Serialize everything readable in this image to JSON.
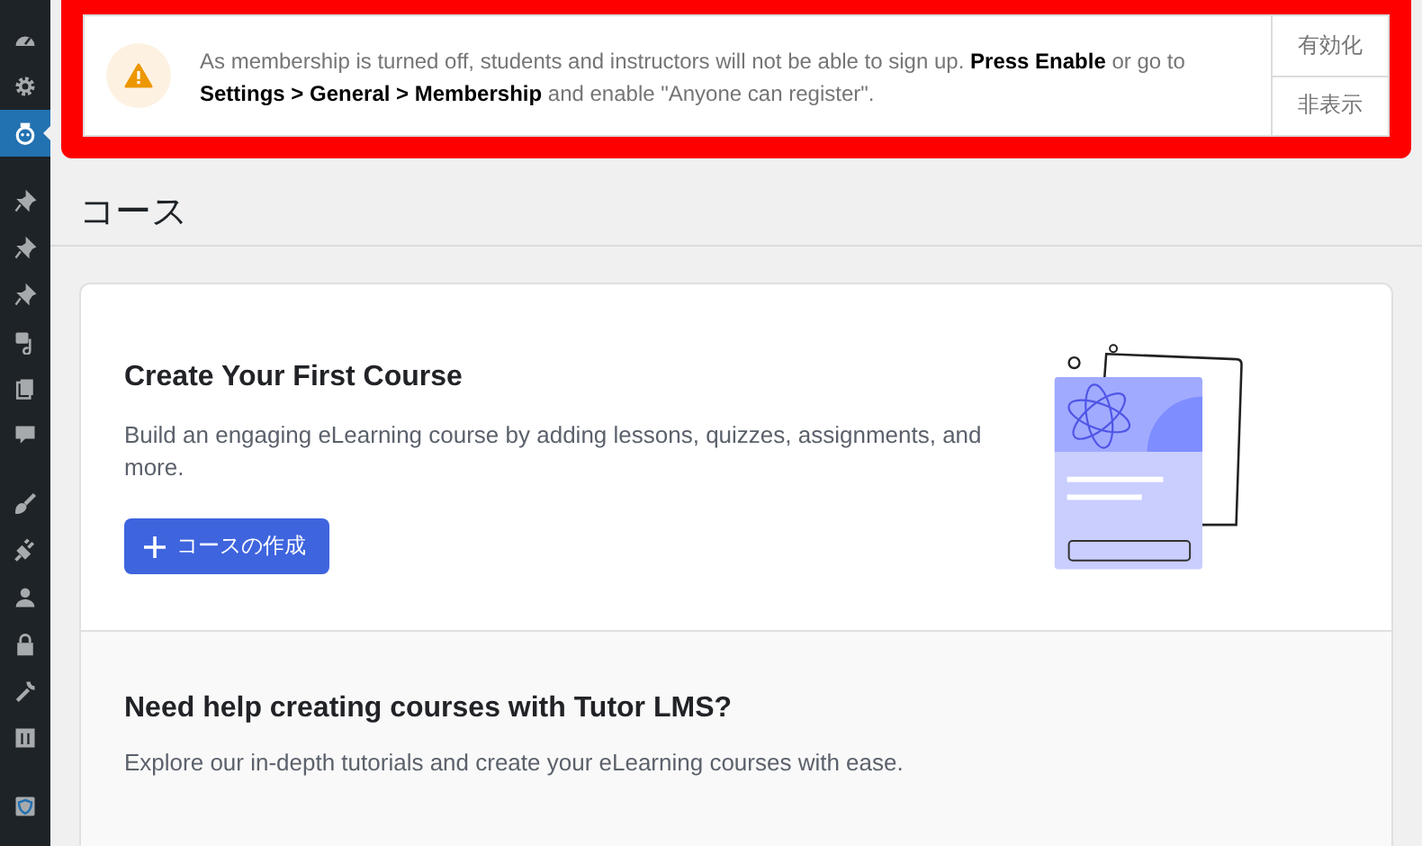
{
  "sidebar": {
    "groups": [
      [
        {
          "kind": "dashboard",
          "selected": false
        },
        {
          "kind": "gear",
          "selected": false
        },
        {
          "kind": "tutor",
          "selected": true
        }
      ],
      [
        {
          "kind": "pin",
          "selected": false
        },
        {
          "kind": "pin",
          "selected": false
        },
        {
          "kind": "pin",
          "selected": false
        },
        {
          "kind": "media",
          "selected": false
        },
        {
          "kind": "pages",
          "selected": false
        },
        {
          "kind": "comment",
          "selected": false
        }
      ],
      [
        {
          "kind": "brush",
          "selected": false
        },
        {
          "kind": "plugin",
          "selected": false
        },
        {
          "kind": "user",
          "selected": false
        },
        {
          "kind": "lock",
          "selected": false
        },
        {
          "kind": "wrench",
          "selected": false
        },
        {
          "kind": "grid",
          "selected": false
        }
      ],
      [
        {
          "kind": "shield",
          "selected": false
        }
      ]
    ]
  },
  "notice": {
    "highlighted": true,
    "message": "As membership is turned off, students and instructors will not be able to sign up. **Press Enable** or go to **Settings > General > Membership** and enable \"Anyone can register\".",
    "actions": [
      "有効化",
      "非表示"
    ]
  },
  "page_title": "コース",
  "empty_state": {
    "title": "Create Your First Course",
    "description": "Build an engaging eLearning course by adding lessons, quizzes, assignments, and more.",
    "button": "コースの作成"
  },
  "help": {
    "title": "Need help creating courses with Tutor LMS?",
    "description": "Explore our in-depth tutorials and create your eLearning courses with ease."
  }
}
